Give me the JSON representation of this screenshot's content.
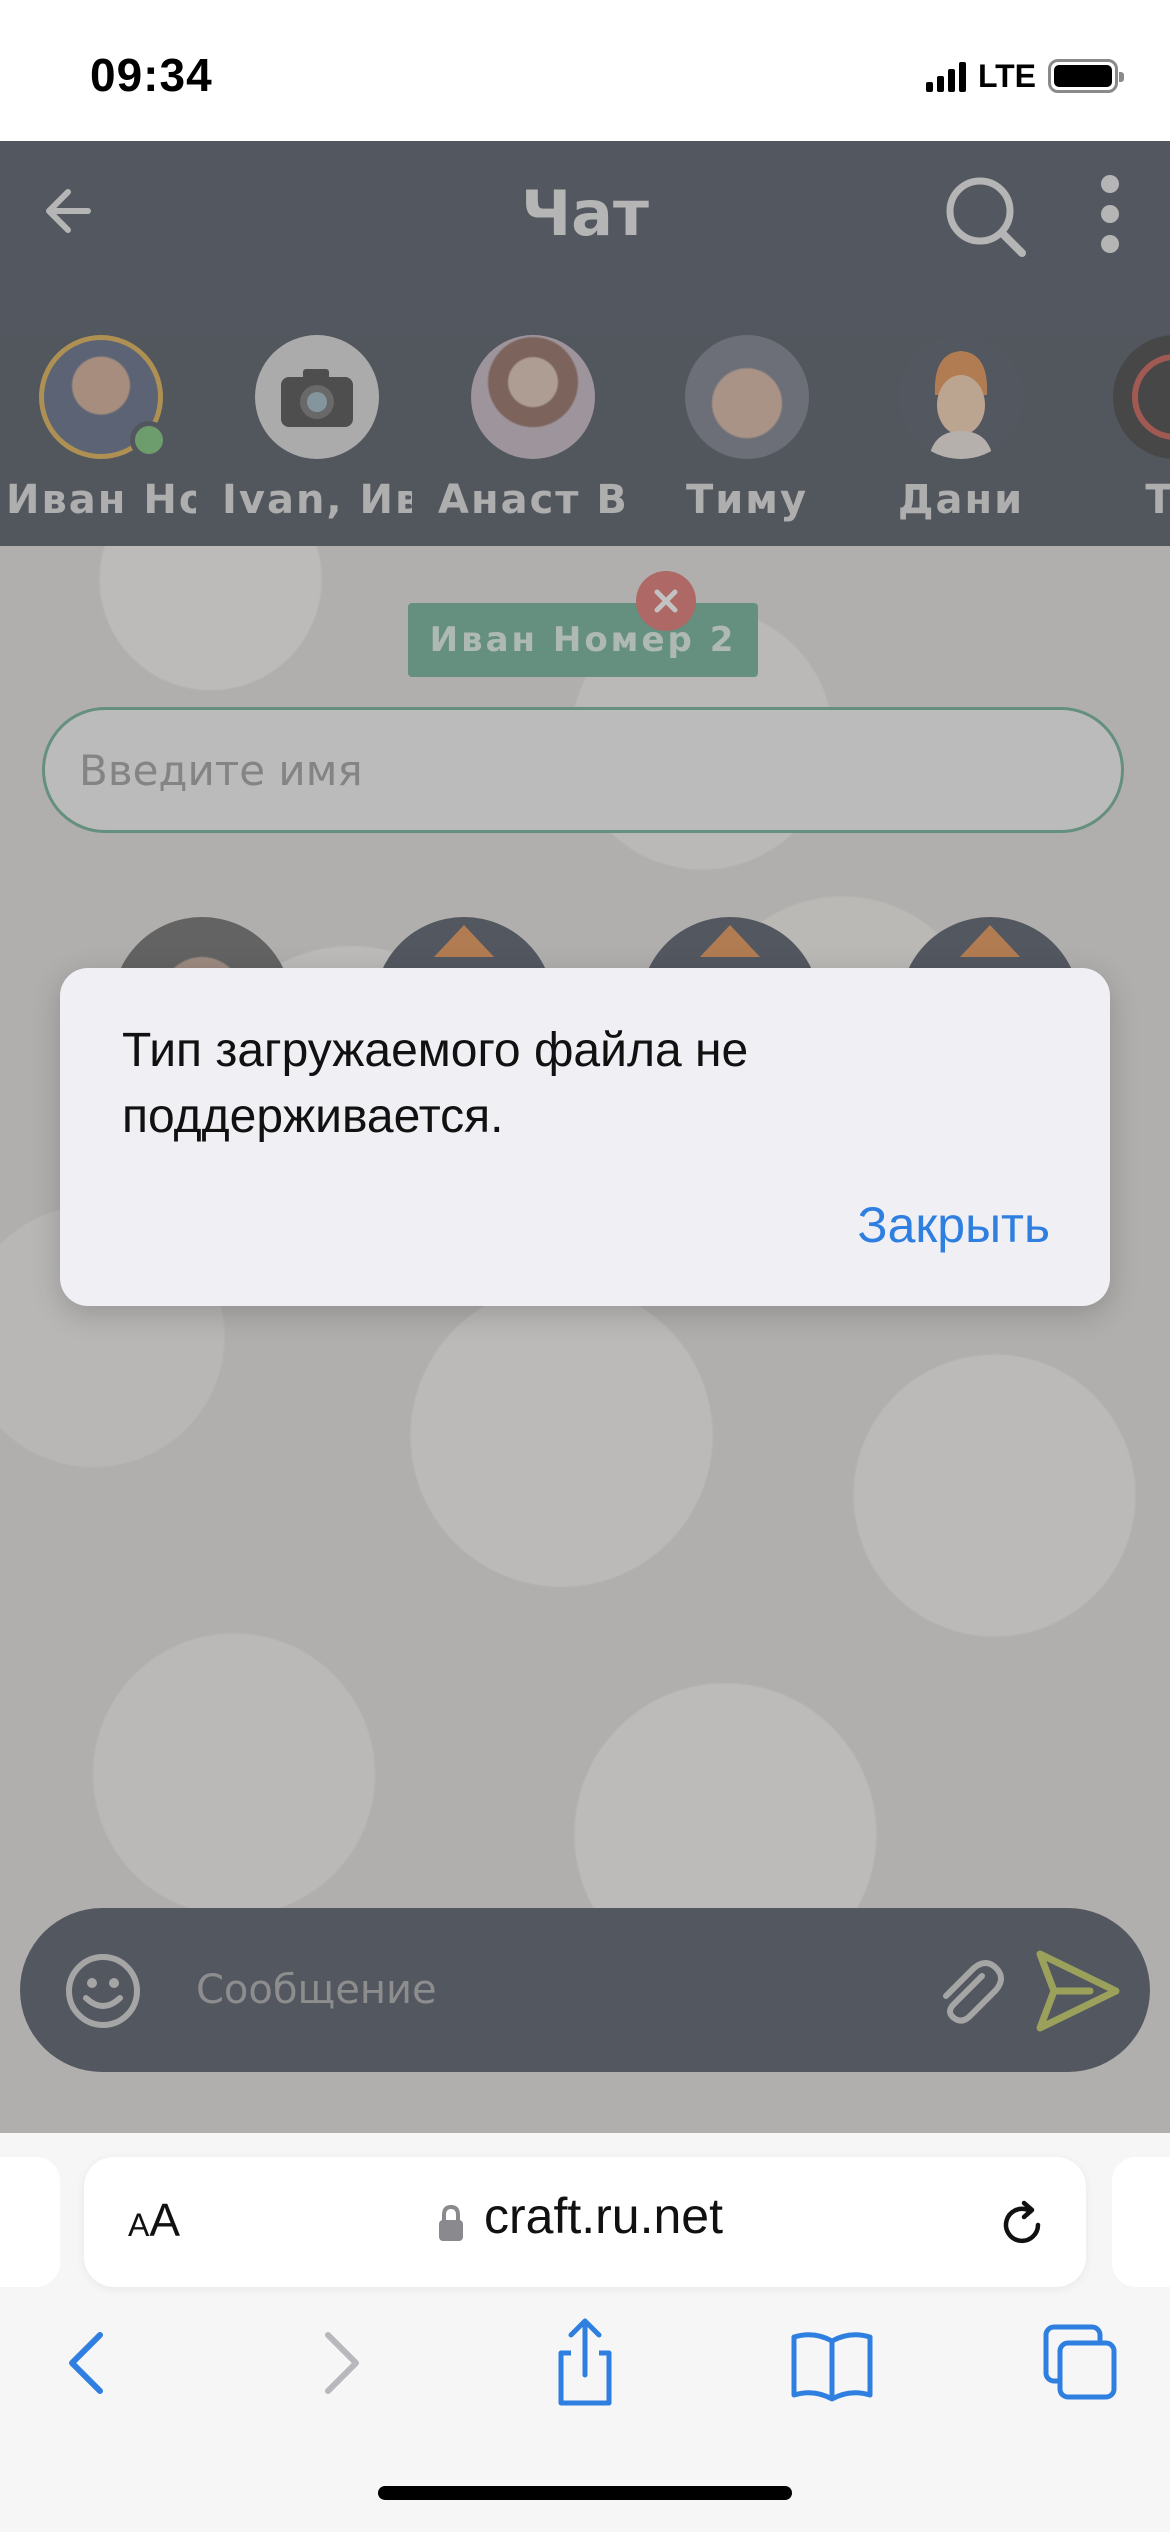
{
  "status_bar": {
    "time": "09:34",
    "network": "LTE"
  },
  "header": {
    "title": "Чат"
  },
  "contacts": [
    {
      "name": "Иван Номе",
      "online": true,
      "avatar": "photo"
    },
    {
      "name": "Ivan, Иван",
      "online": false,
      "avatar": "camera"
    },
    {
      "name": "Анаст Висо",
      "online": false,
      "avatar": "photo"
    },
    {
      "name": "Тиму",
      "online": false,
      "avatar": "photo"
    },
    {
      "name": "Дани",
      "online": false,
      "avatar": "placeholder"
    },
    {
      "name": "Ти",
      "online": false,
      "avatar": "placeholder"
    }
  ],
  "selected_tag": {
    "label": "Иван Номер 2"
  },
  "name_search": {
    "placeholder": "Введите имя",
    "value": ""
  },
  "composer": {
    "placeholder": "Сообщение",
    "value": ""
  },
  "alert": {
    "message": "Тип загружаемого файла не поддерживается.",
    "close_label": "Закрыть"
  },
  "browser": {
    "aa_small": "A",
    "aa_big": "A",
    "url": "craft.ru.net"
  },
  "colors": {
    "header_bg": "#2b3444",
    "accent_green": "#4d9d7f",
    "link_blue": "#2f7fe0",
    "online_green": "#5cb85c",
    "tag_close_red": "#d9534f"
  }
}
